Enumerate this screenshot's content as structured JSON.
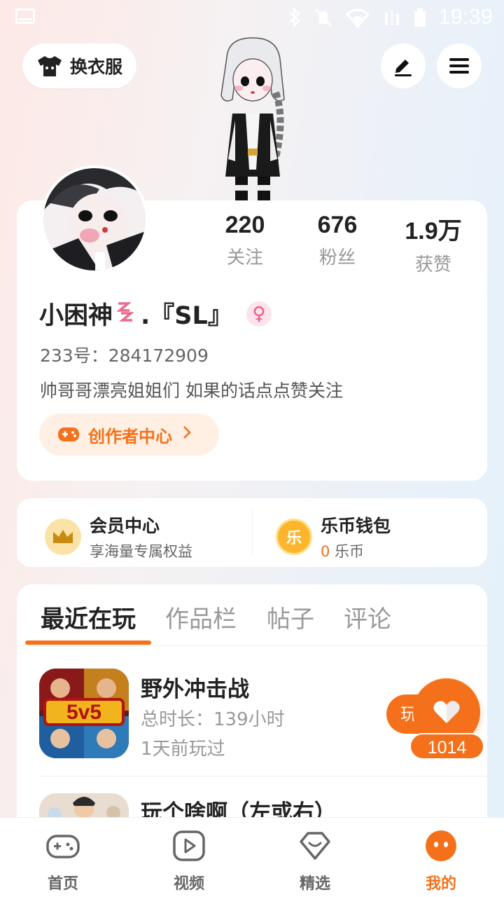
{
  "status_bar": {
    "time": "19:39"
  },
  "header": {
    "outfit_label": "换衣服"
  },
  "profile": {
    "stats": [
      {
        "value": "220",
        "label": "关注"
      },
      {
        "value": "676",
        "label": "粉丝"
      },
      {
        "value": "1.9万",
        "label": "获赞"
      }
    ],
    "name_prefix": "小困神",
    "name_suffix": ".『SL』",
    "gender_symbol": "♀",
    "uid": "233号：284172909",
    "bio": "帅哥哥漂亮姐姐们 如果的话点点赞关注",
    "creator_label": "创作者中心"
  },
  "vip": {
    "member_title": "会员中心",
    "member_sub": "享海量专属权益",
    "wallet_title": "乐币钱包",
    "wallet_count": "0",
    "wallet_unit": " 乐币",
    "coin_char": "乐"
  },
  "tabs": [
    "最近在玩",
    "作品栏",
    "帖子",
    "评论"
  ],
  "games": [
    {
      "title": "野外冲击战",
      "duration": "总时长：139小时",
      "last_played": "1天前玩过",
      "badge": "5v5"
    },
    {
      "title": "玩个啥啊（左或右）"
    }
  ],
  "play_button": "玩",
  "like_count": "1014",
  "nav": [
    {
      "label": "首页"
    },
    {
      "label": "视频"
    },
    {
      "label": "精选"
    },
    {
      "label": "我的"
    }
  ],
  "colors": {
    "accent": "#f5701a",
    "pink": "#ee5a88"
  }
}
